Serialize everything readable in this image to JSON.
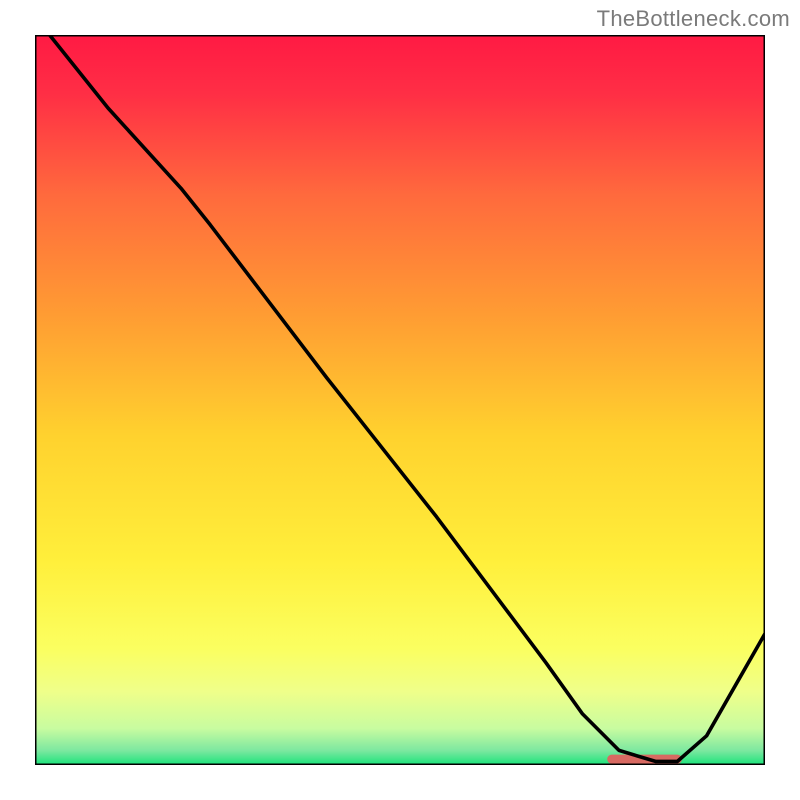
{
  "attribution": "TheBottleneck.com",
  "chart_data": {
    "type": "line",
    "title": "",
    "xlabel": "",
    "ylabel": "",
    "xlim": [
      0,
      100
    ],
    "ylim": [
      0,
      100
    ],
    "grid": false,
    "series": [
      {
        "name": "curve",
        "x": [
          2,
          10,
          20,
          24,
          40,
          55,
          70,
          75,
          80,
          85,
          88,
          92,
          100
        ],
        "values": [
          100,
          90,
          79,
          74,
          53,
          34,
          14,
          7,
          2,
          0.5,
          0.5,
          4,
          18
        ]
      },
      {
        "name": "marker-band",
        "x": [
          79,
          88
        ],
        "values": [
          0.8,
          0.8
        ]
      }
    ],
    "gradient_stops": [
      {
        "offset": 0.0,
        "color": "#ff1a44"
      },
      {
        "offset": 0.08,
        "color": "#ff2e45"
      },
      {
        "offset": 0.22,
        "color": "#ff6a3d"
      },
      {
        "offset": 0.38,
        "color": "#ff9b33"
      },
      {
        "offset": 0.55,
        "color": "#ffd22e"
      },
      {
        "offset": 0.72,
        "color": "#ffef3b"
      },
      {
        "offset": 0.84,
        "color": "#fbff60"
      },
      {
        "offset": 0.9,
        "color": "#efff8a"
      },
      {
        "offset": 0.95,
        "color": "#c8fca0"
      },
      {
        "offset": 0.98,
        "color": "#7de8a0"
      },
      {
        "offset": 1.0,
        "color": "#19e37a"
      }
    ],
    "marker_color": "#d86a62"
  }
}
